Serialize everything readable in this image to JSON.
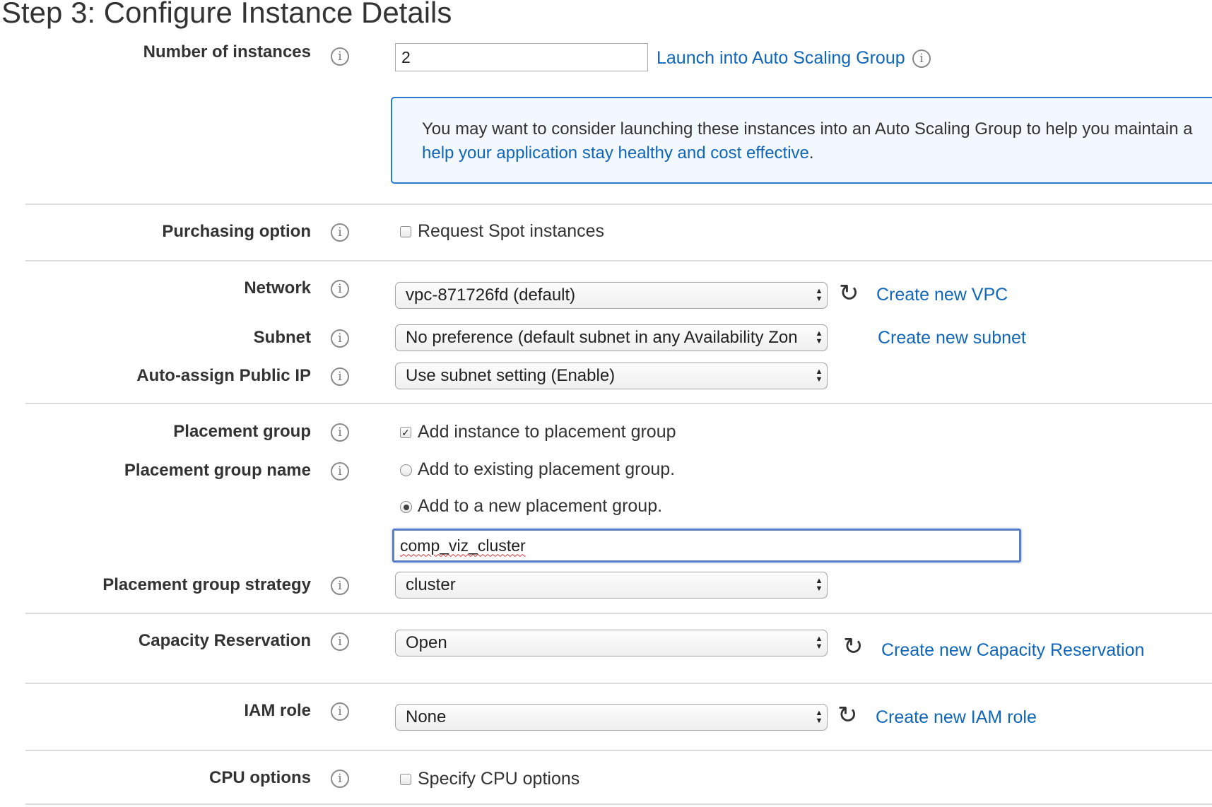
{
  "page": {
    "title": "Step 3: Configure Instance Details"
  },
  "fields": {
    "number_of_instances": {
      "label": "Number of instances",
      "value": "2",
      "link": "Launch into Auto Scaling Group"
    },
    "notice": {
      "text": "You may want to consider launching these instances into an Auto Scaling Group to help you maintain a",
      "link": "help your application stay healthy and cost effective",
      "suffix": "."
    },
    "purchasing_option": {
      "label": "Purchasing option",
      "checkbox_label": "Request Spot instances",
      "checked": false
    },
    "network": {
      "label": "Network",
      "selected": "vpc-871726fd (default)",
      "link": "Create new VPC"
    },
    "subnet": {
      "label": "Subnet",
      "selected": "No preference (default subnet in any Availability Zon",
      "link": "Create new subnet"
    },
    "auto_assign_ip": {
      "label": "Auto-assign Public IP",
      "selected": "Use subnet setting (Enable)"
    },
    "placement_group": {
      "label": "Placement group",
      "checkbox_label": "Add instance to placement group",
      "checked": true
    },
    "placement_group_name": {
      "label": "Placement group name",
      "option_existing": "Add to existing placement group.",
      "option_new": "Add to a new placement group.",
      "selected_option": "new",
      "value": "comp_viz_cluster"
    },
    "placement_group_strategy": {
      "label": "Placement group strategy",
      "selected": "cluster"
    },
    "capacity_reservation": {
      "label": "Capacity Reservation",
      "selected": "Open",
      "link": "Create new Capacity Reservation"
    },
    "iam_role": {
      "label": "IAM role",
      "selected": "None",
      "link": "Create new IAM role"
    },
    "cpu_options": {
      "label": "CPU options",
      "checkbox_label": "Specify CPU options",
      "checked": false
    }
  },
  "icons": {
    "info": "info-icon",
    "refresh": "refresh-icon",
    "select_arrows": "select-arrows-icon"
  },
  "colors": {
    "link": "#1066bb",
    "notice_border": "#2a7bd0",
    "notice_bg": "#f2f8fd",
    "focus_border": "#5b7fc9"
  }
}
